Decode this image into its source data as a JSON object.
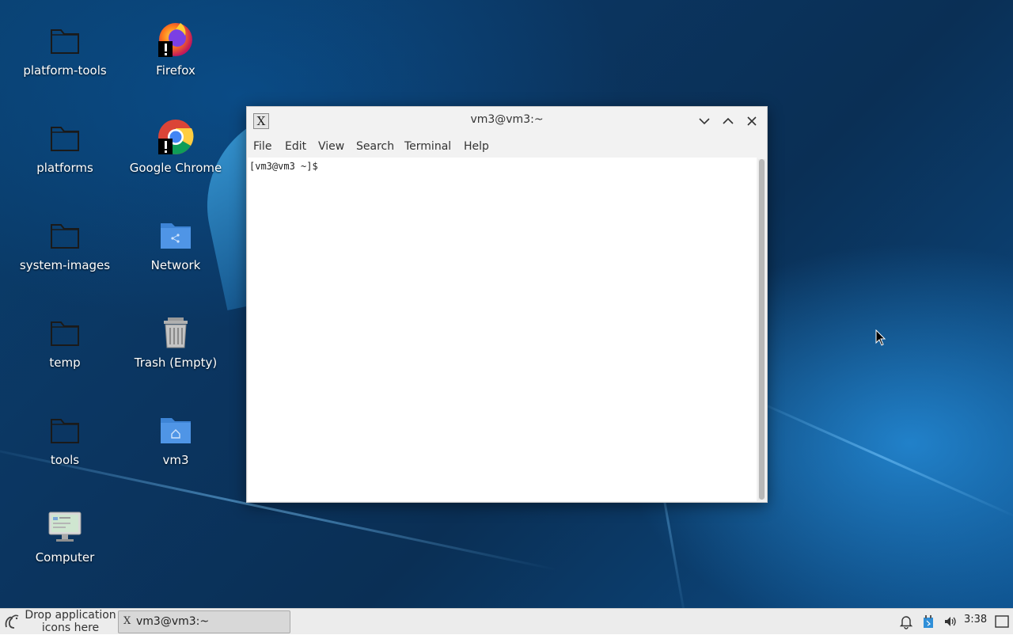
{
  "desktop": {
    "icons": [
      {
        "label": "platform-tools",
        "icon": "folder-icon"
      },
      {
        "label": "Firefox",
        "icon": "firefox-icon"
      },
      {
        "label": "platforms",
        "icon": "folder-icon"
      },
      {
        "label": "Google Chrome",
        "icon": "chrome-icon"
      },
      {
        "label": "system-images",
        "icon": "folder-icon"
      },
      {
        "label": "Network",
        "icon": "network-folder-icon"
      },
      {
        "label": "temp",
        "icon": "folder-icon"
      },
      {
        "label": "Trash (Empty)",
        "icon": "trash-icon"
      },
      {
        "label": "tools",
        "icon": "folder-icon"
      },
      {
        "label": "vm3",
        "icon": "home-folder-icon"
      },
      {
        "label": "Computer",
        "icon": "computer-icon"
      }
    ]
  },
  "terminal": {
    "title": "vm3@vm3:~",
    "app_icon_glyph": "X",
    "menu": [
      "File",
      "Edit",
      "View",
      "Search",
      "Terminal",
      "Help"
    ],
    "prompt": "[vm3@vm3 ~]$"
  },
  "taskbar": {
    "launcher_hint": "Drop application icons here",
    "task_title": "vm3@vm3:~",
    "task_icon_glyph": "X",
    "clock": "3:38",
    "tray_icons": [
      "bell-icon",
      "network-status-icon",
      "volume-icon",
      "show-desktop-icon"
    ]
  },
  "colors": {
    "folder_outline": "#1a1a1a",
    "folder_blue": "#3d84d6",
    "desktop_dark": "#0a3f6e",
    "desktop_light": "#2896e6"
  }
}
